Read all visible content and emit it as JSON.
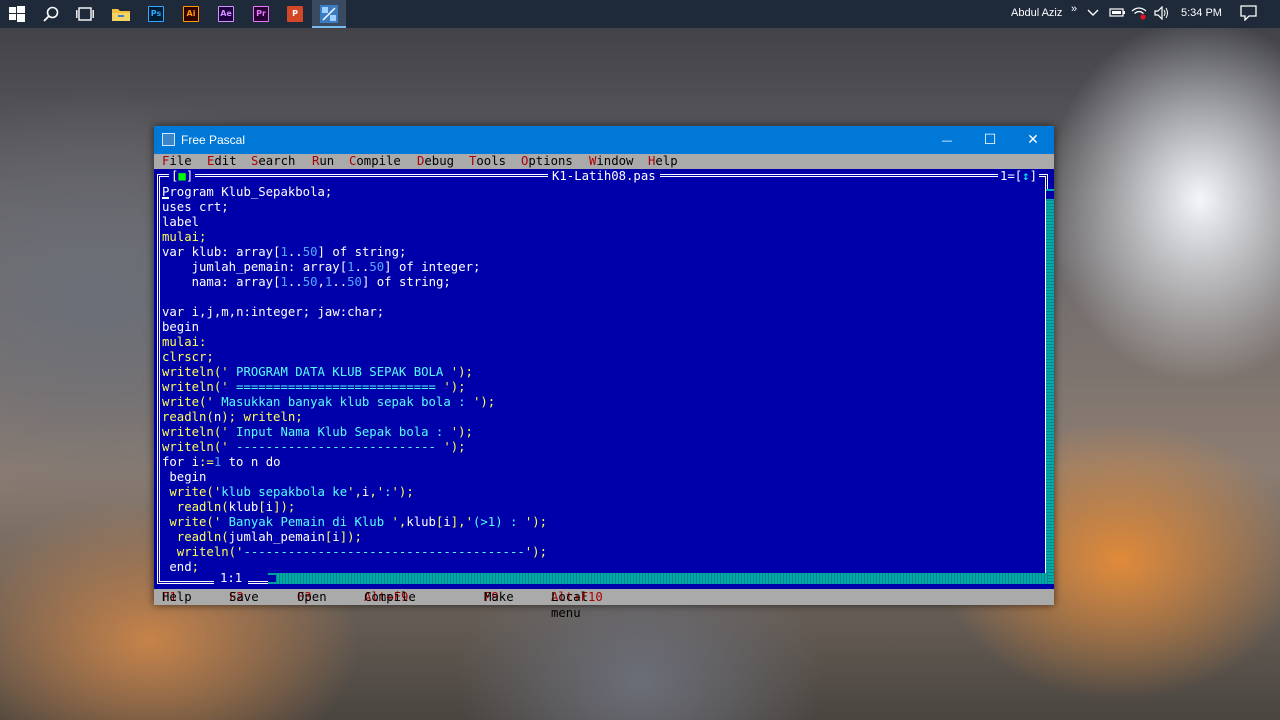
{
  "taskbar": {
    "apps": [
      {
        "name": "start-icon"
      },
      {
        "name": "search-icon"
      },
      {
        "name": "task-view-icon"
      },
      {
        "name": "file-explorer-icon"
      },
      {
        "name": "photoshop-icon",
        "label": "Ps",
        "color": "#31a8ff"
      },
      {
        "name": "illustrator-icon",
        "label": "Ai",
        "color": "#ff9a00"
      },
      {
        "name": "after-effects-icon",
        "label": "Ae",
        "color": "#d291ff"
      },
      {
        "name": "premiere-icon",
        "label": "Pr",
        "color": "#ea77ff"
      },
      {
        "name": "powerpoint-icon",
        "label": "P",
        "color": "#d24726"
      },
      {
        "name": "free-pascal-icon"
      }
    ],
    "user": "Abdul Aziz",
    "overflow": "»",
    "time": "5:34 PM"
  },
  "window": {
    "title": "Free Pascal",
    "minimize": "—",
    "maximize": "☐",
    "close": "✕"
  },
  "menu": [
    "File",
    "Edit",
    "Search",
    "Run",
    "Compile",
    "Debug",
    "Tools",
    "Options",
    "Window",
    "Help"
  ],
  "editor": {
    "filename": "K1-Latih08.pas",
    "close_box": "■",
    "window_number": "1",
    "zoom_box": "↕",
    "position": "1:1"
  },
  "code_lines": [
    "Program Klub_Sepakbola;",
    "uses crt;",
    "label",
    "mulai;",
    "var klub: array[1..50] of string;",
    "    jumlah_pemain: array[1..50] of integer;",
    "    nama: array[1..50,1..50] of string;",
    "",
    "var i,j,m,n:integer; jaw:char;",
    "begin",
    "mulai:",
    "clrscr;",
    "writeln(' PROGRAM DATA KLUB SEPAK BOLA ');",
    "writeln(' =========================== ');",
    "write(' Masukkan banyak klub sepak bola : ');",
    "readln(n); writeln;",
    "writeln(' Input Nama Klub Sepak bola : ');",
    "writeln(' --------------------------- ');",
    "for i:=1 to n do",
    " begin",
    " write('klub sepakbola ke',i,':');",
    "  readln(klub[i]);",
    " write(' Banyak Pemain di Klub ',klub[i],'(>1) : ');",
    "  readln(jumlah_pemain[i]);",
    "  writeln('--------------------------------------');",
    " end;"
  ],
  "status": [
    {
      "key": "F1",
      "label": "Help"
    },
    {
      "key": "F2",
      "label": "Save"
    },
    {
      "key": "F3",
      "label": "Open"
    },
    {
      "key": "Alt+F9",
      "label": "Compile"
    },
    {
      "key": "F9",
      "label": "Make"
    },
    {
      "key": "Alt+F10",
      "label": "Local menu"
    }
  ],
  "colors": {
    "editor_bg": "#0000aa",
    "code_text": "#ffff55",
    "string_text": "#55ffff",
    "number_text": "#55aaff",
    "menu_bg": "#aaaaaa",
    "hotkey": "#aa0000",
    "titlebar": "#0078d7"
  }
}
